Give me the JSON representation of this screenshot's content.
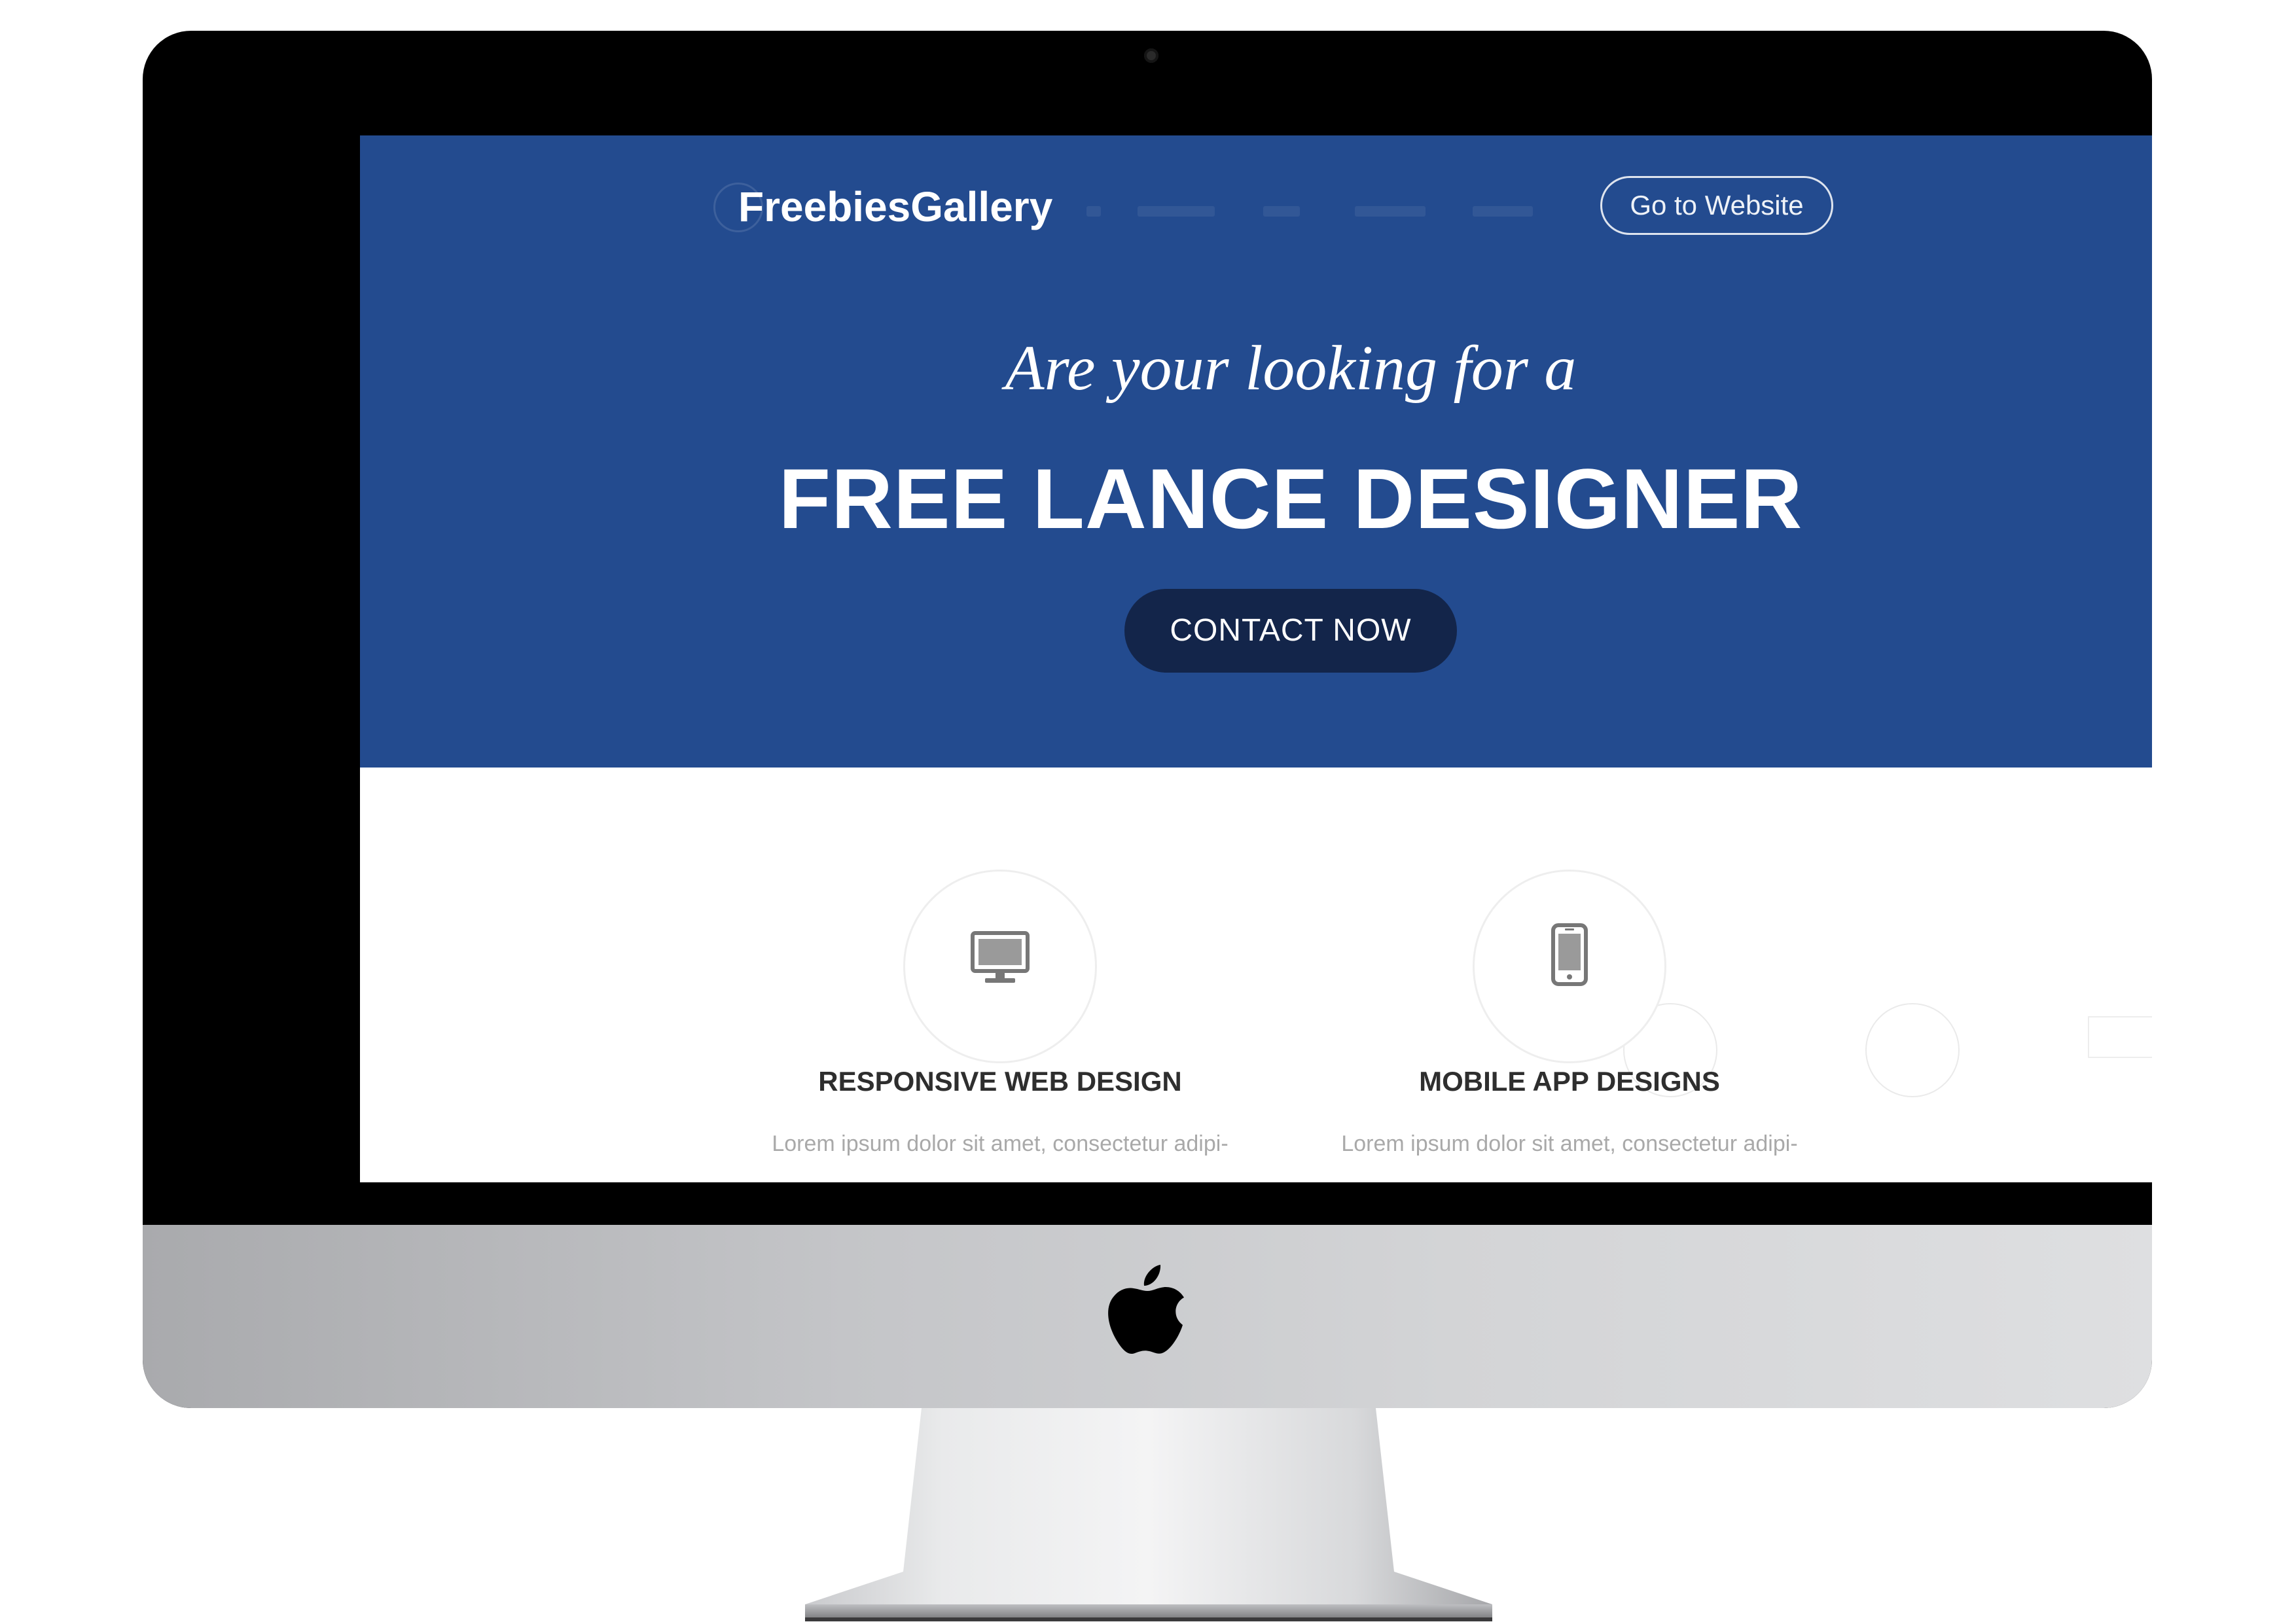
{
  "header": {
    "brand": "FreebiesGallery",
    "goto_button": "Go to Website"
  },
  "hero": {
    "tagline": "Are your looking for a",
    "headline": "FREE LANCE DESIGNER",
    "cta": "CONTACT NOW"
  },
  "features": [
    {
      "icon": "desktop-monitor-icon",
      "title": "RESPONSIVE WEB DESIGN",
      "text": "Lorem ipsum dolor sit amet, consectetur adipi-"
    },
    {
      "icon": "smartphone-icon",
      "title": "MOBILE APP DESIGNS",
      "text": "Lorem ipsum dolor sit amet, consectetur adipi-"
    }
  ],
  "colors": {
    "hero_background": "#234b8f",
    "cta_background": "#13254a",
    "device_bezel": "#000000",
    "device_chin": "#cfd0d2"
  }
}
